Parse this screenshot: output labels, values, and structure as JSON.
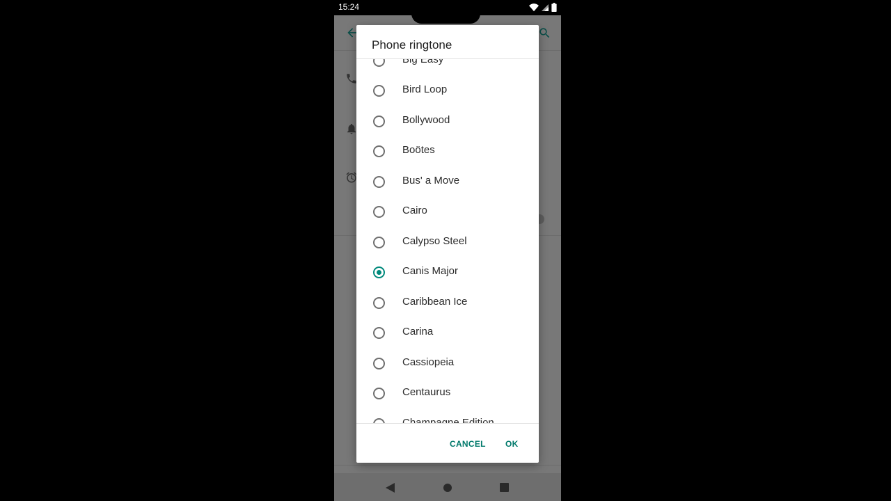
{
  "status_bar": {
    "time": "15:24"
  },
  "icons": {
    "back": "arrow-back-icon",
    "search": "search-icon",
    "phone": "phone-icon",
    "bell": "bell-icon",
    "alarm": "alarm-icon",
    "wifi": "wifi-icon",
    "signal": "signal-icon",
    "battery": "battery-icon"
  },
  "colors": {
    "accent": "#00897b",
    "button_text": "#00796b"
  },
  "dialog": {
    "title": "Phone ringtone",
    "options": [
      {
        "label": "Big Easy",
        "checked": false
      },
      {
        "label": "Bird Loop",
        "checked": false
      },
      {
        "label": "Bollywood",
        "checked": false
      },
      {
        "label": "Boötes",
        "checked": false
      },
      {
        "label": "Bus' a Move",
        "checked": false
      },
      {
        "label": "Cairo",
        "checked": false
      },
      {
        "label": "Calypso Steel",
        "checked": false
      },
      {
        "label": "Canis Major",
        "checked": true
      },
      {
        "label": "Caribbean Ice",
        "checked": false
      },
      {
        "label": "Carina",
        "checked": false
      },
      {
        "label": "Cassiopeia",
        "checked": false
      },
      {
        "label": "Centaurus",
        "checked": false
      },
      {
        "label": "Champagne Edition",
        "checked": false
      }
    ],
    "cancel_label": "CANCEL",
    "ok_label": "OK"
  },
  "nav_bar": {
    "back": "nav-back-icon",
    "home": "nav-home-icon",
    "recents": "nav-recents-icon"
  }
}
